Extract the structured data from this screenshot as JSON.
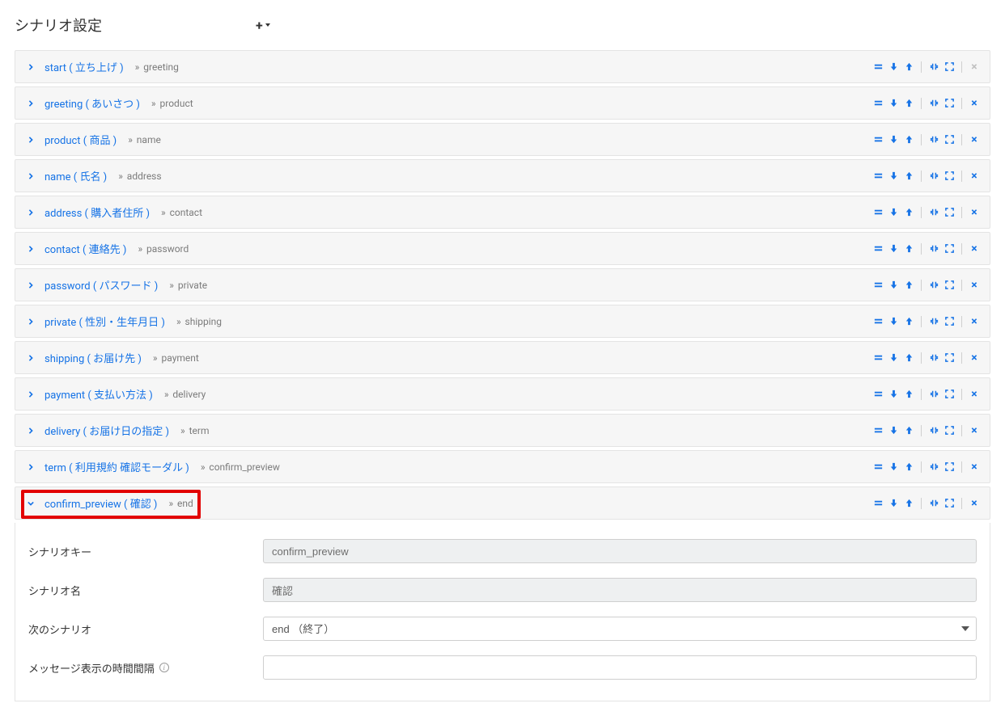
{
  "page_title": "シナリオ設定",
  "scenarios": [
    {
      "toggle": "right",
      "label": "start ( 立ち上げ )",
      "next": "greeting",
      "closeDisabled": true
    },
    {
      "toggle": "right",
      "label": "greeting ( あいさつ )",
      "next": "product",
      "closeDisabled": false
    },
    {
      "toggle": "right",
      "label": "product ( 商品 )",
      "next": "name",
      "closeDisabled": false
    },
    {
      "toggle": "right",
      "label": "name ( 氏名 )",
      "next": "address",
      "closeDisabled": false
    },
    {
      "toggle": "right",
      "label": "address ( 購入者住所 )",
      "next": "contact",
      "closeDisabled": false
    },
    {
      "toggle": "right",
      "label": "contact ( 連絡先 )",
      "next": "password",
      "closeDisabled": false
    },
    {
      "toggle": "right",
      "label": "password ( パスワード )",
      "next": "private",
      "closeDisabled": false
    },
    {
      "toggle": "right",
      "label": "private ( 性別・生年月日 )",
      "next": "shipping",
      "closeDisabled": false
    },
    {
      "toggle": "right",
      "label": "shipping ( お届け先 )",
      "next": "payment",
      "closeDisabled": false
    },
    {
      "toggle": "right",
      "label": "payment ( 支払い方法 )",
      "next": "delivery",
      "closeDisabled": false
    },
    {
      "toggle": "right",
      "label": "delivery ( お届け日の指定 )",
      "next": "term",
      "closeDisabled": false
    },
    {
      "toggle": "right",
      "label": "term ( 利用規約 確認モーダル )",
      "next": "confirm_preview",
      "closeDisabled": false
    },
    {
      "toggle": "down",
      "label": "confirm_preview ( 確認 )",
      "next": "end",
      "closeDisabled": false,
      "highlight": true,
      "expanded": true
    }
  ],
  "details": {
    "fields": {
      "key_label": "シナリオキー",
      "key_value": "confirm_preview",
      "name_label": "シナリオ名",
      "name_value": "確認",
      "next_label": "次のシナリオ",
      "next_value": "end （終了）",
      "interval_label": "メッセージ表示の時間間隔",
      "interval_value": ""
    }
  }
}
